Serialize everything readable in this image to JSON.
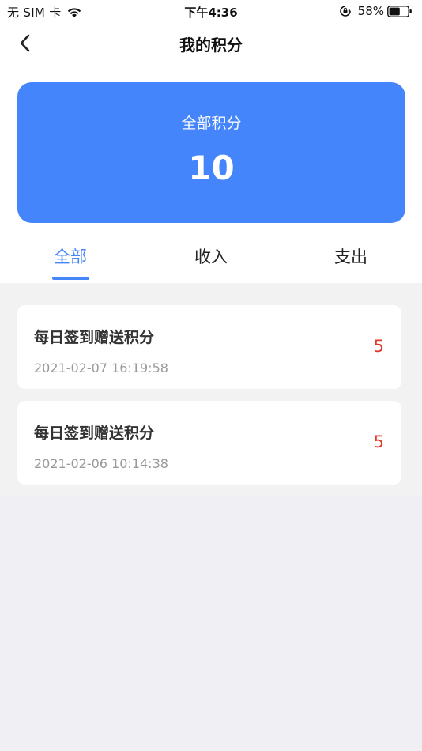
{
  "status_bar": {
    "carrier": "无 SIM 卡",
    "time": "下午4:36",
    "battery_percent": "58%",
    "battery_level": 0.58
  },
  "nav": {
    "title": "我的积分",
    "back_icon": "chevron-left-icon"
  },
  "summary": {
    "label": "全部积分",
    "value": "10",
    "card_color": "#4485fb"
  },
  "tabs": [
    {
      "label": "全部",
      "active": true
    },
    {
      "label": "收入",
      "active": false
    },
    {
      "label": "支出",
      "active": false
    }
  ],
  "records": [
    {
      "title": "每日签到赠送积分",
      "time": "2021-02-07 16:19:58",
      "amount": "5"
    },
    {
      "title": "每日签到赠送积分",
      "time": "2021-02-06 10:14:38",
      "amount": "5"
    }
  ],
  "colors": {
    "accent": "#4485fb",
    "amount": "#e0392b"
  }
}
